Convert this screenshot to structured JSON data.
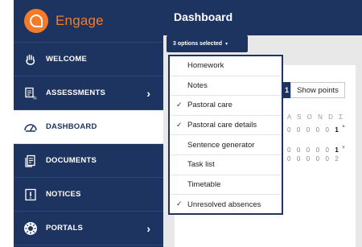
{
  "brand": {
    "name": "Engage"
  },
  "sidebar": {
    "items": [
      {
        "label": "WELCOME",
        "icon": "hand-wave-icon",
        "has_chevron": false,
        "active": false
      },
      {
        "label": "ASSESSMENTS",
        "icon": "assessment-percent-icon",
        "has_chevron": true,
        "active": false
      },
      {
        "label": "DASHBOARD",
        "icon": "speedometer-icon",
        "has_chevron": false,
        "active": true
      },
      {
        "label": "DOCUMENTS",
        "icon": "document-icon",
        "has_chevron": false,
        "active": false
      },
      {
        "label": "NOTICES",
        "icon": "notice-exclamation-icon",
        "has_chevron": false,
        "active": false
      },
      {
        "label": "PORTALS",
        "icon": "portal-icon",
        "has_chevron": true,
        "active": false
      }
    ]
  },
  "header": {
    "title": "Dashboard"
  },
  "filter": {
    "button_label": "3 options selected",
    "caret": "▾"
  },
  "dropdown": {
    "options": [
      {
        "label": "Homework",
        "checked": false
      },
      {
        "label": "Notes",
        "checked": false
      },
      {
        "label": "Pastoral care",
        "checked": true
      },
      {
        "label": "Pastoral care details",
        "checked": true
      },
      {
        "label": "Sentence generator",
        "checked": false
      },
      {
        "label": "Task list",
        "checked": false
      },
      {
        "label": "Timetable",
        "checked": false
      },
      {
        "label": "Unresolved absences",
        "checked": true
      }
    ]
  },
  "panel": {
    "stub_value": "1",
    "show_points_label": "Show points",
    "months_header": "A S O N D Σ",
    "row1": "0 0 0 0 0",
    "row1_total": "1",
    "row2": "0 0 0 0 0",
    "row2_total": "1",
    "row3": "0 0 0 0 0 2"
  },
  "colors": {
    "navy": "#1d3461",
    "accent": "#f47b2a"
  }
}
